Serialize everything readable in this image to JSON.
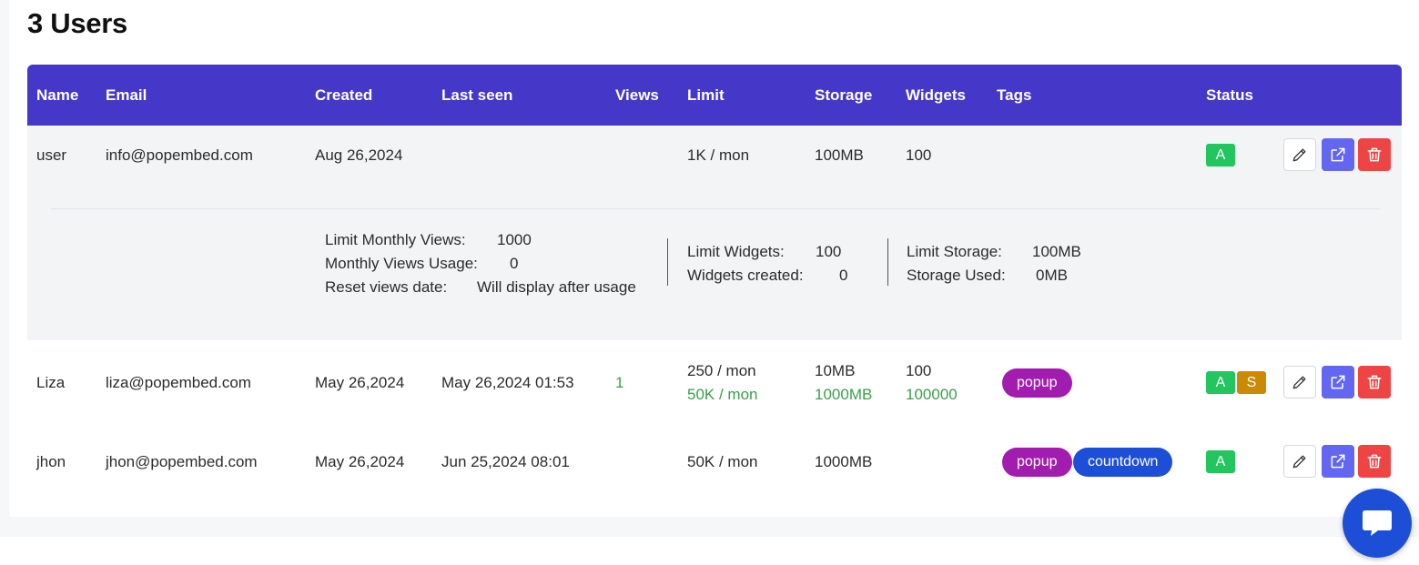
{
  "page": {
    "title": "3 Users"
  },
  "table": {
    "columns": [
      "Name",
      "Email",
      "Created",
      "Last seen",
      "Views",
      "Limit",
      "Storage",
      "Widgets",
      "Tags",
      "Status"
    ],
    "rows": [
      {
        "name": "user",
        "email": "info@popembed.com",
        "created": "Aug 26,2024",
        "last_seen": "",
        "views": "",
        "limit": "1K / mon",
        "storage": "100MB",
        "widgets": "100",
        "tags": [],
        "status": [
          "A"
        ],
        "details": {
          "limit_monthly_views_label": "Limit Monthly Views:",
          "limit_monthly_views": "1000",
          "monthly_views_usage_label": "Monthly Views Usage:",
          "monthly_views_usage": "0",
          "reset_views_date_label": "Reset views date:",
          "reset_views_date": "Will display after usage",
          "limit_widgets_label": "Limit Widgets:",
          "limit_widgets": "100",
          "widgets_created_label": "Widgets created:",
          "widgets_created": "0",
          "limit_storage_label": "Limit Storage:",
          "limit_storage": "100MB",
          "storage_used_label": "Storage Used:",
          "storage_used": "0MB"
        }
      },
      {
        "name": "Liza",
        "email": "liza@popembed.com",
        "created": "May 26,2024",
        "last_seen": "May 26,2024 01:53",
        "views": "1",
        "limit": "250 / mon",
        "limit_secondary": "50K / mon",
        "storage": "10MB",
        "storage_secondary": "1000MB",
        "widgets": "100",
        "widgets_secondary": "100000",
        "tags": [
          "popup"
        ],
        "status": [
          "A",
          "S"
        ]
      },
      {
        "name": "jhon",
        "email": "jhon@popembed.com",
        "created": "May 26,2024",
        "last_seen": "Jun 25,2024 08:01",
        "views": "",
        "limit": "50K / mon",
        "storage": "1000MB",
        "widgets": "",
        "tags": [
          "popup",
          "countdown"
        ],
        "status": [
          "A"
        ]
      }
    ]
  },
  "icons": {
    "edit": "pencil-icon",
    "open": "external-link-icon",
    "delete": "trash-icon",
    "chat": "chat-icon"
  },
  "colors": {
    "header_bg": "#4538c9",
    "badge_active": "#22c55e",
    "badge_s": "#ca8a04",
    "tag_popup": "#a21caf",
    "tag_countdown": "#1d4ed8",
    "btn_open": "#6366f1",
    "btn_delete": "#ef4444",
    "secondary_value": "#3aa04a"
  }
}
